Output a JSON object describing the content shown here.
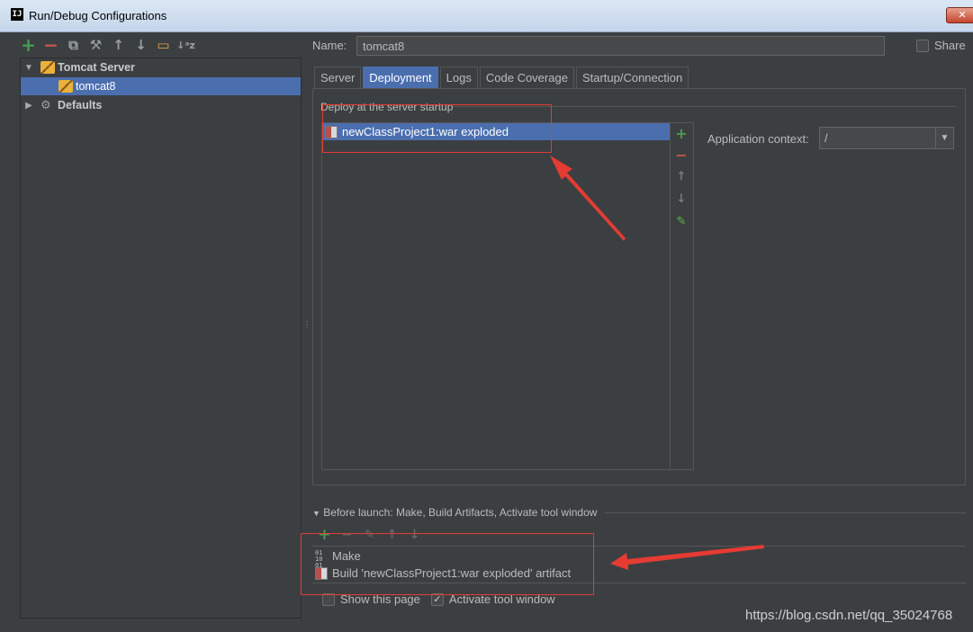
{
  "window": {
    "title": "Run/Debug Configurations",
    "app_icon": "IJ"
  },
  "left_toolbar": {
    "icons": [
      "add-icon",
      "remove-icon",
      "copy-icon",
      "edit-defaults-icon",
      "move-up-icon",
      "move-down-icon",
      "folder-icon",
      "sort-icon"
    ]
  },
  "tree": {
    "items": [
      {
        "label": "Tomcat Server",
        "icon": "tomcat-icon",
        "expanded": true
      },
      {
        "label": "tomcat8",
        "icon": "tomcat-icon",
        "selected": true
      },
      {
        "label": "Defaults",
        "icon": "defaults-icon",
        "expanded": false
      }
    ]
  },
  "form": {
    "name_label": "Name:",
    "name_value": "tomcat8",
    "share_label": "Share",
    "share_checked": false
  },
  "tabs": [
    {
      "label": "Server"
    },
    {
      "label": "Deployment",
      "active": true
    },
    {
      "label": "Logs"
    },
    {
      "label": "Code Coverage"
    },
    {
      "label": "Startup/Connection"
    }
  ],
  "deployment": {
    "section_label": "Deploy at the server startup",
    "items": [
      "newClassProject1:war exploded"
    ],
    "context_label": "Application context:",
    "context_value": "/"
  },
  "before_launch": {
    "label": "Before launch: Make, Build Artifacts, Activate tool window",
    "items": [
      "Make",
      "Build 'newClassProject1:war exploded' artifact"
    ],
    "show_page_label": "Show this page",
    "show_page_checked": false,
    "activate_label": "Activate tool window",
    "activate_checked": true
  },
  "annotation": {
    "color": "#e53b33"
  },
  "watermark": "https://blog.csdn.net/qq_35024768",
  "colors": {
    "background": "#3c3f41",
    "selection": "#4b6eaf",
    "add": "#499c54",
    "remove": "#c75450"
  }
}
